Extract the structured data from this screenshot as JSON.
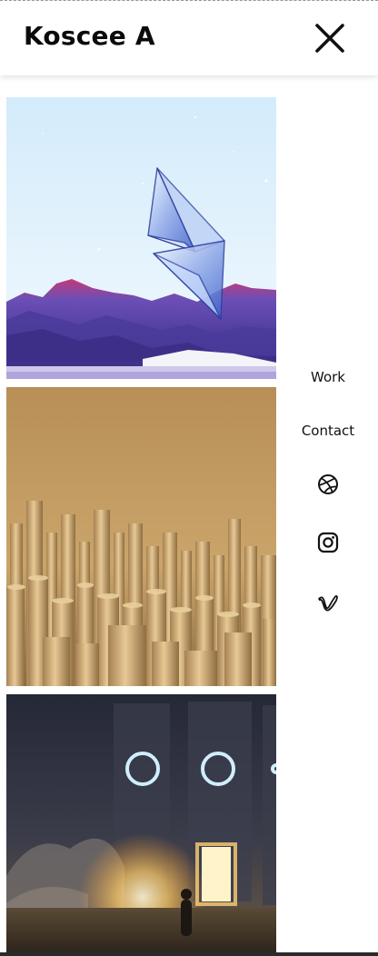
{
  "header": {
    "brand_name": "Koscee A",
    "close_icon": "close-x-icon"
  },
  "gallery": {
    "items": [
      {
        "name": "ethereum-crystal-mountains-artwork",
        "colors": {
          "sky": "#dbeefa",
          "mountain": "#5a4aa8",
          "ridge": "#c23a7a"
        }
      },
      {
        "name": "golden-cylinders-letters-artwork",
        "colors": {
          "background": "#b8955e",
          "cylinder": "#d6b27a"
        }
      },
      {
        "name": "glowing-rings-portal-artwork",
        "colors": {
          "sky": "#2b2e3b",
          "glow": "#ffe7a3",
          "ring": "#bfe6ff"
        }
      }
    ]
  },
  "menu": {
    "work_label": "Work",
    "contact_label": "Contact",
    "social": [
      {
        "icon": "dribbble-icon"
      },
      {
        "icon": "instagram-icon"
      },
      {
        "icon": "vimeo-icon"
      }
    ]
  }
}
